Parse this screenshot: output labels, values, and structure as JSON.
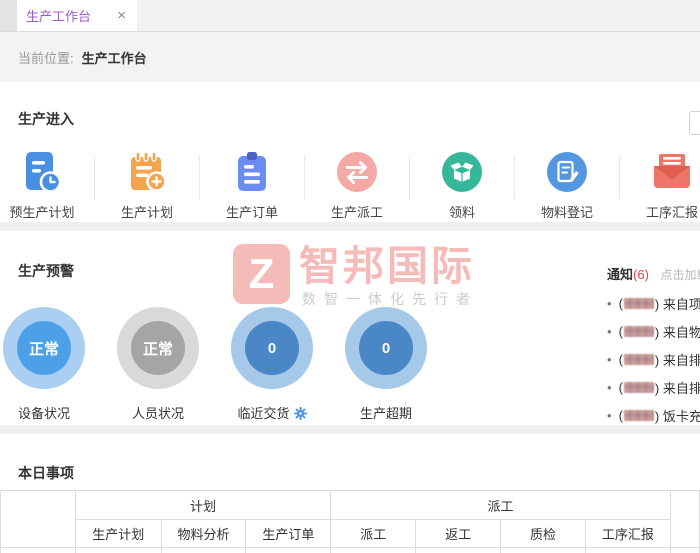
{
  "tab": {
    "title": "生产工作台",
    "close_icon": "×"
  },
  "breadcrumb": {
    "label": "当前位置:",
    "value": "生产工作台"
  },
  "colors": {
    "tab_active_text": "#9a5fc7",
    "notice_count_red": "#e64545",
    "watermark_red": "rgba(232,92,86,0.42)",
    "gauge_blue_bright": "#4da0e8",
    "gauge_gray": "#a5a5a5",
    "gauge_blue_steel": "#4a87c6"
  },
  "entry": {
    "title": "生产进入",
    "items": [
      {
        "label": "预生产计划",
        "icon": "pre-production-plan-icon",
        "color": "#4a90e2"
      },
      {
        "label": "生产计划",
        "icon": "production-plan-icon",
        "color": "#f5a34d"
      },
      {
        "label": "生产订单",
        "icon": "production-order-icon",
        "color": "#6c8cf5"
      },
      {
        "label": "生产派工",
        "icon": "production-dispatch-icon",
        "color": "#f4a9a4"
      },
      {
        "label": "领料",
        "icon": "material-pick-icon",
        "color": "#35b89a"
      },
      {
        "label": "物料登记",
        "icon": "material-register-icon",
        "color": "#5596e0"
      },
      {
        "label": "工序汇报",
        "icon": "process-report-icon",
        "color": "#ed7668"
      }
    ]
  },
  "warning": {
    "title": "生产预警",
    "gauges": [
      {
        "label": "设备状况",
        "value": "正常",
        "inner": "#4da0e8",
        "ring": "#abcff2",
        "has_gear": false
      },
      {
        "label": "人员状况",
        "value": "正常",
        "inner": "#a5a5a5",
        "ring": "#d9d9d9",
        "has_gear": false
      },
      {
        "label": "临近交货",
        "value": "0",
        "inner": "#4a87c6",
        "ring": "#a6c9e9",
        "has_gear": true
      },
      {
        "label": "生产超期",
        "value": "0",
        "inner": "#4a87c6",
        "ring": "#a6c9e9",
        "has_gear": false
      }
    ]
  },
  "notices": {
    "title": "通知",
    "count": "(6)",
    "more": "点击加载",
    "bullet": "•",
    "items": [
      {
        "open": "(",
        "text": ") 来自项"
      },
      {
        "open": "(",
        "text": ") 来自物"
      },
      {
        "open": "(",
        "text": ") 来自排"
      },
      {
        "open": "(",
        "text": ") 来自排"
      },
      {
        "open": "(",
        "text": ") 饭卡充"
      }
    ]
  },
  "today": {
    "title": "本日事项",
    "table": {
      "groups": [
        {
          "label": "计划",
          "span": 3
        },
        {
          "label": "派工",
          "span": 4
        }
      ],
      "columns": [
        "生产计划",
        "物料分析",
        "生产订单",
        "派工",
        "返工",
        "质检",
        "工序汇报"
      ]
    }
  },
  "watermark": {
    "logo": "Z",
    "brand": "智邦国际",
    "slogan": "数智一体化先行者"
  }
}
